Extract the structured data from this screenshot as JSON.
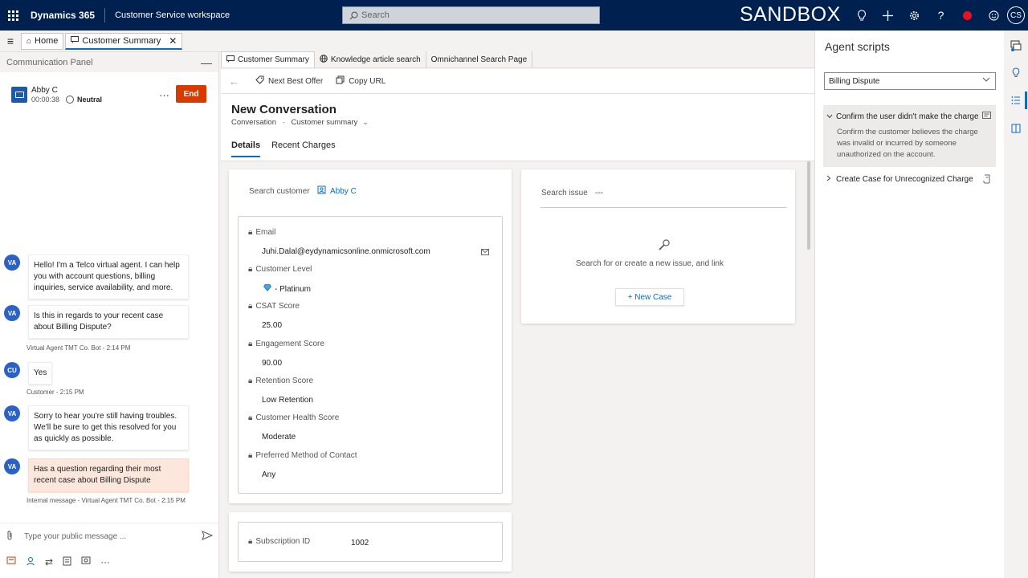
{
  "topbar": {
    "brand": "Dynamics 365",
    "app_name": "Customer Service workspace",
    "search_placeholder": "Search",
    "environment": "SANDBOX",
    "user_initials": "CS"
  },
  "session_tabs": [
    {
      "label": "Home"
    },
    {
      "label": "Customer Summary"
    }
  ],
  "comm_panel": {
    "title": "Communication Panel",
    "customer_name": "Abby C",
    "elapsed": "00:00:38",
    "sentiment": "Neutral",
    "end_label": "End",
    "messages": [
      {
        "avatar": "VA",
        "text": "Hello! I'm a Telco virtual agent. I can help you with account questions, billing inquiries, service availability, and more."
      },
      {
        "avatar": "VA",
        "text": "Is this in regards to your recent case about Billing Dispute?",
        "meta": "Virtual Agent TMT Co. Bot - 2:14 PM"
      },
      {
        "avatar": "CU",
        "text": "Yes",
        "meta": "Customer - 2:15 PM"
      },
      {
        "avatar": "VA",
        "text": "Sorry to hear you're still having troubles.  We'll be sure to get this resolved for you as quickly as possible."
      },
      {
        "avatar": "VA",
        "text": "Has a question regarding their most recent case about Billing Dispute",
        "meta": "Internal message - Virtual Agent TMT Co. Bot - 2:15 PM"
      }
    ],
    "compose_placeholder": "Type your public message ..."
  },
  "main_tabs": [
    {
      "label": "Customer Summary"
    },
    {
      "label": "Knowledge article search"
    },
    {
      "label": "Omnichannel Search Page"
    }
  ],
  "commands": {
    "next_best_offer": "Next Best Offer",
    "copy_url": "Copy URL"
  },
  "form": {
    "title": "New Conversation",
    "entity": "Conversation",
    "separator": "·",
    "form_name": "Customer summary",
    "tabs": [
      "Details",
      "Recent Charges"
    ]
  },
  "customer_card": {
    "search_label": "Search customer",
    "customer": "Abby C",
    "fields": [
      {
        "label": "Email",
        "value": "Juhi.Dalal@eydynamicsonline.onmicrosoft.com"
      },
      {
        "label": "Customer Level",
        "value": "- Platinum"
      },
      {
        "label": "CSAT Score",
        "value": "25.00"
      },
      {
        "label": "Engagement Score",
        "value": "90.00"
      },
      {
        "label": "Retention Score",
        "value": "Low Retention"
      },
      {
        "label": "Customer Health Score",
        "value": "Moderate"
      },
      {
        "label": "Preferred Method of Contact",
        "value": "Any"
      }
    ],
    "subscription_label": "Subscription ID",
    "subscription_value": "1002"
  },
  "issue_card": {
    "search_label": "Search issue",
    "search_value": "---",
    "empty_text": "Search for or create a new issue, and link",
    "new_case_label": "+ New Case"
  },
  "agent_scripts": {
    "title": "Agent scripts",
    "selected": "Billing Dispute",
    "steps": [
      {
        "title": "Confirm the user didn't make the charge",
        "description": "Confirm the customer believes the charge was invalid or incurred by someone unauthorized on the account."
      },
      {
        "title": "Create Case for Unrecognized Charge"
      }
    ]
  },
  "colors": {
    "topbar": "#002050",
    "accent": "#0f6cbd",
    "end_button": "#d83b01",
    "internal_message": "#fde7dc"
  }
}
